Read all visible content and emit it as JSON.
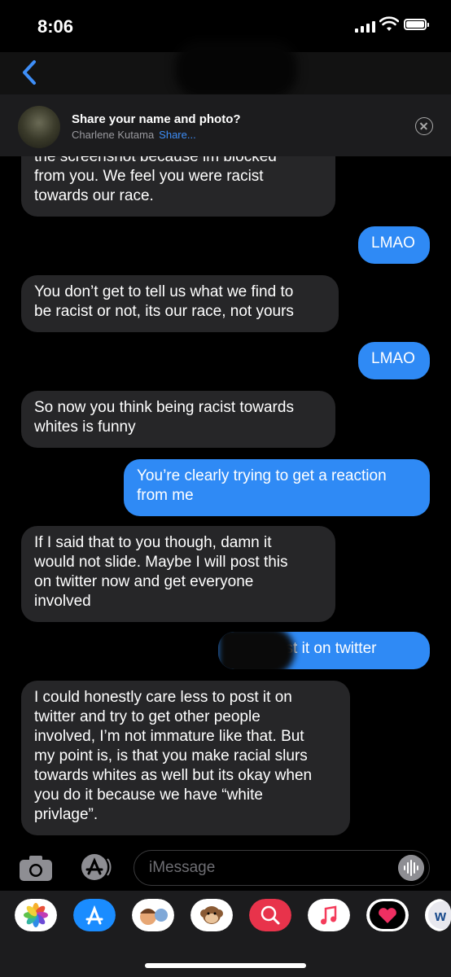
{
  "status": {
    "time": "8:06"
  },
  "share_banner": {
    "title": "Share your name and photo?",
    "name": "Charlene Kutama",
    "action": "Share..."
  },
  "messages": [
    {
      "dir": "in",
      "lines": [
        "the screenshot because im blocked",
        "from you. We feel you were racist",
        "towards our race."
      ]
    },
    {
      "dir": "out",
      "lines": [
        "LMAO"
      ]
    },
    {
      "dir": "in",
      "lines": [
        "You don’t get to tell us what we find to",
        "be racist or not, its our race, not yours"
      ]
    },
    {
      "dir": "out",
      "lines": [
        "LMAO"
      ]
    },
    {
      "dir": "in",
      "lines": [
        "So now you think being racist towards",
        "whites is funny"
      ]
    },
    {
      "dir": "out",
      "lines": [
        "You’re clearly trying to get a reaction",
        "from me"
      ]
    },
    {
      "dir": "in",
      "lines": [
        "If I  said that to you though, damn it",
        "would not slide. Maybe I  will post this",
        "on twitter now and get everyone",
        "involved"
      ]
    },
    {
      "dir": "out",
      "lines": [
        "Do    a post it on twitter"
      ]
    },
    {
      "dir": "in",
      "lines": [
        "I  could honestly care less to post it on",
        "twitter and try to get other people",
        "involved, I’m not immature like that. But",
        "my point is, is that you make racial slurs",
        "towards whites as well but its okay when",
        "you do it because we have “white",
        "privlage”."
      ]
    }
  ],
  "compose": {
    "placeholder": "iMessage"
  },
  "app_drawer": [
    {
      "icon": "photos-icon",
      "color": "#ffffff"
    },
    {
      "icon": "app-store-icon",
      "color": "#1a8cff"
    },
    {
      "icon": "memoji-stickers-icon",
      "color": "#ffffff"
    },
    {
      "icon": "animoji-monkey-icon",
      "color": "#ffffff"
    },
    {
      "icon": "web-search-icon",
      "color": "#e8334b"
    },
    {
      "icon": "music-icon",
      "color": "#ffffff"
    },
    {
      "icon": "digital-touch-icon",
      "color": "#000000"
    },
    {
      "icon": "partial-app-icon",
      "color": "#ffffff"
    }
  ]
}
